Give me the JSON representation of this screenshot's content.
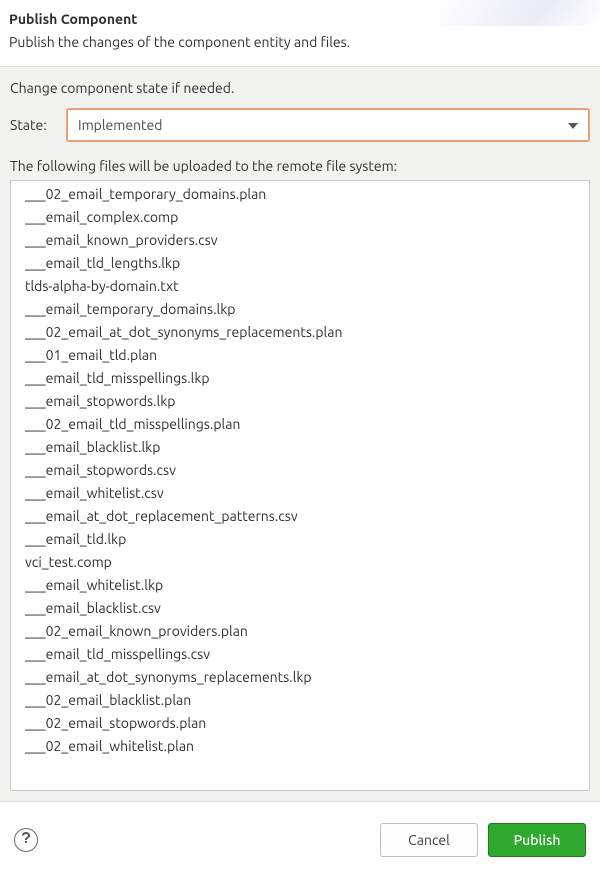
{
  "header": {
    "title": "Publish Component",
    "subtitle": "Publish the changes of the component entity and files."
  },
  "main": {
    "instruction": "Change component state if needed.",
    "state_label": "State:",
    "state_value": "Implemented",
    "upload_label": "The following files will be uploaded to the remote file system:",
    "files": [
      "___02_email_temporary_domains.plan",
      "___email_complex.comp",
      "___email_known_providers.csv",
      "___email_tld_lengths.lkp",
      "tlds-alpha-by-domain.txt",
      "___email_temporary_domains.lkp",
      "___02_email_at_dot_synonyms_replacements.plan",
      "___01_email_tld.plan",
      "___email_tld_misspellings.lkp",
      "___email_stopwords.lkp",
      "___02_email_tld_misspellings.plan",
      "___email_blacklist.lkp",
      "___email_stopwords.csv",
      "___email_whitelist.csv",
      "___email_at_dot_replacement_patterns.csv",
      "___email_tld.lkp",
      "vci_test.comp",
      "___email_whitelist.lkp",
      "___email_blacklist.csv",
      "___02_email_known_providers.plan",
      "___email_tld_misspellings.csv",
      "___email_at_dot_synonyms_replacements.lkp",
      "___02_email_blacklist.plan",
      "___02_email_stopwords.plan",
      "___02_email_whitelist.plan"
    ]
  },
  "footer": {
    "cancel": "Cancel",
    "publish": "Publish"
  }
}
